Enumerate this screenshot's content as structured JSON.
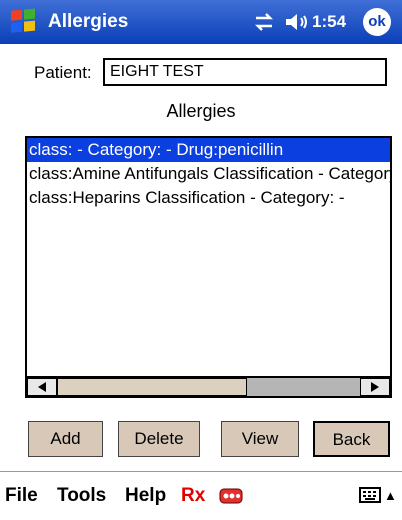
{
  "titlebar": {
    "title": "Allergies",
    "time": "1:54",
    "ok_label": "ok"
  },
  "patient": {
    "label": "Patient:",
    "value": "EIGHT TEST"
  },
  "section_title": "Allergies",
  "allergies": {
    "items": [
      "class: - Category: - Drug:penicillin",
      "class:Amine Antifungals Classification - Category: -",
      "class:Heparins Classification - Category: -"
    ],
    "selected_index": 0
  },
  "buttons": {
    "add": "Add",
    "delete": "Delete",
    "view": "View",
    "back": "Back"
  },
  "menu": {
    "file": "File",
    "tools": "Tools",
    "help": "Help",
    "rx": "Rx"
  },
  "icons": {
    "start": "windows-flag-icon",
    "connectivity": "connectivity-icon",
    "volume": "speaker-icon",
    "pills": "pills-icon",
    "keyboard": "keyboard-icon"
  },
  "colors": {
    "titlebar": "#0b3fb8",
    "selection": "#0b3fe0",
    "button_face": "#d8c8b8",
    "rx": "#e00000"
  }
}
